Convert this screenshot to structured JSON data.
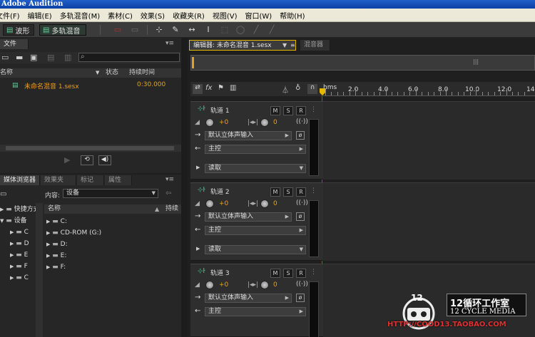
{
  "app": {
    "title": "Adobe Audition"
  },
  "menu": [
    "文件(F)",
    "编辑(E)",
    "多轨混音(M)",
    "素材(C)",
    "效果(S)",
    "收藏夹(R)",
    "视图(V)",
    "窗口(W)",
    "帮助(H)"
  ],
  "toolbar": {
    "waveform_label": "波形",
    "multitrack_label": "多轨混音"
  },
  "files_panel": {
    "tab": "文件",
    "columns": {
      "name": "名称",
      "status": "状态",
      "duration": "持续时间"
    },
    "items": [
      {
        "name": "未命名混音 1.sesx",
        "duration": "0:30.000"
      }
    ]
  },
  "browser_panel": {
    "tabs": [
      "媒体浏览器",
      "效果夹",
      "标记",
      "属性"
    ],
    "content_label": "内容:",
    "content_value": "设备",
    "tree": [
      "快捷方式",
      "设备",
      "C",
      "D",
      "E",
      "F",
      "C"
    ],
    "column_name": "名称",
    "column_duration": "持续",
    "drives": [
      "C:",
      "CD-ROM (G:)",
      "D:",
      "E:",
      "F:"
    ]
  },
  "editor": {
    "tab": "编辑器: 未命名混音 1.sesx",
    "mixer_tab": "混音器",
    "ruler_unit": "hms",
    "ruler": [
      "2.0",
      "4.0",
      "6.0",
      "8.0",
      "10.0",
      "12.0",
      "14"
    ],
    "tracks": [
      {
        "name": "轨道 1",
        "volume": "+0",
        "pan": "0",
        "input": "默认立体声输入",
        "output": "主控",
        "automation": "读取"
      },
      {
        "name": "轨道 2",
        "volume": "+0",
        "pan": "0",
        "input": "默认立体声输入",
        "output": "主控",
        "automation": "读取"
      },
      {
        "name": "轨道 3",
        "volume": "+0",
        "pan": "0",
        "input": "默认立体声输入",
        "output": "主控",
        "automation": ""
      }
    ]
  },
  "watermark": {
    "title": "12循环工作室",
    "subtitle": "12 CYCLE MEDIA",
    "url": "HTTP://COOD13.TAOBAO.COM"
  },
  "colors": {
    "accent": "#e8a020",
    "selection_green": "#2f9a6a",
    "playhead": "#e6b800"
  }
}
